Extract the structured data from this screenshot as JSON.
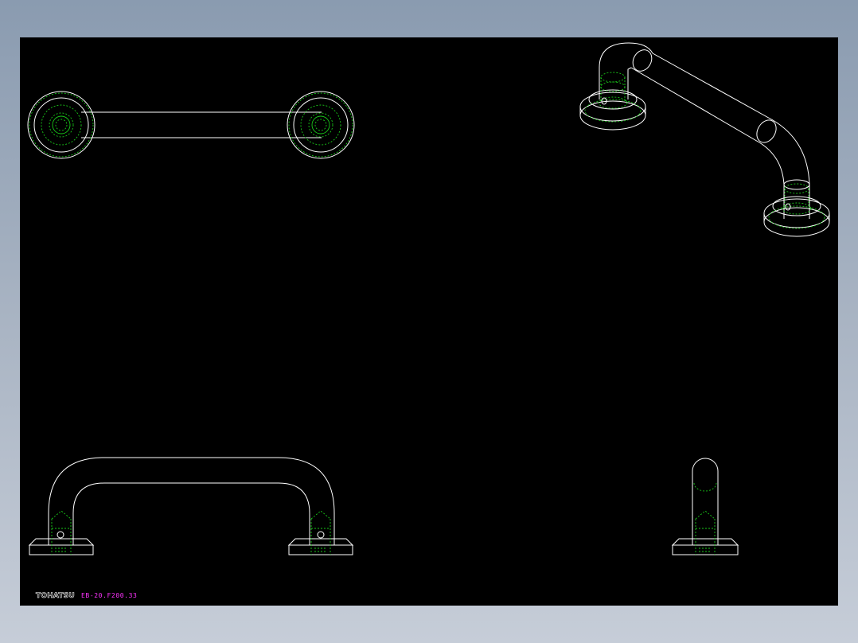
{
  "title_block": {
    "brand": "TOHATSU",
    "model_number": "EB-20.F200.33"
  },
  "colors": {
    "background": "#000000",
    "outline": "#ffffff",
    "hidden_lines": "#19c719",
    "model_text": "#ff33ff",
    "window_frame": "#9aa8ba"
  }
}
